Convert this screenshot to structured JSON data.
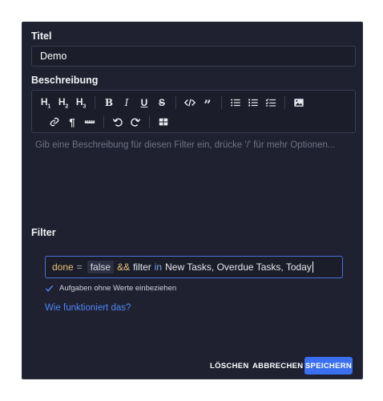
{
  "form": {
    "title_label": "Titel",
    "title_value": "Demo",
    "description_label": "Beschreibung",
    "description_placeholder": "Gib eine Beschreibung für diesen Filter ein, drücke '/' für mehr Optionen...",
    "filter_label": "Filter",
    "filter_query": {
      "key": "done",
      "op": "=",
      "value": "false",
      "and": "&&",
      "field": "filter",
      "in": "in",
      "list": "New Tasks, Overdue Tasks, Today"
    },
    "include_nulls_label": "Aufgaben ohne Werte einbeziehen",
    "include_nulls_checked": true,
    "help_link": "Wie funktioniert das?"
  },
  "toolbar": {
    "row1": [
      "heading-1",
      "heading-2",
      "heading-3",
      "bold",
      "italic",
      "underline",
      "strikethrough",
      "code",
      "quote",
      "bullet-list",
      "ordered-list",
      "task-list",
      "image"
    ],
    "row2": [
      "link",
      "paragraph",
      "horizontal-rule",
      "undo",
      "redo",
      "table"
    ]
  },
  "buttons": {
    "delete": "LÖSCHEN",
    "cancel": "ABBRECHEN",
    "save": "SPEICHERN"
  },
  "colors": {
    "panel_bg": "#1f2130",
    "accent": "#3a6ff0",
    "link": "#4f86f7",
    "token_key": "#e8c37a"
  }
}
